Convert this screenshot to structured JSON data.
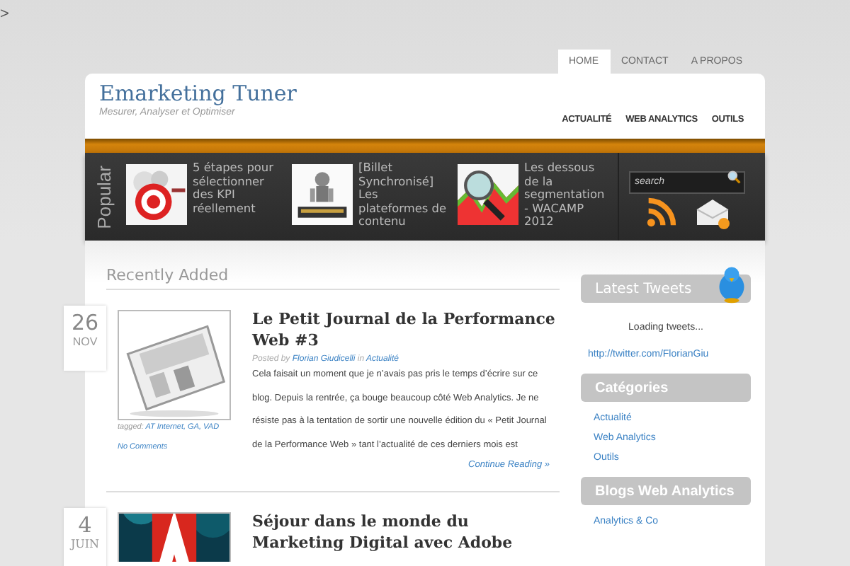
{
  "top_marker": ">",
  "top_tabs": [
    {
      "label": "HOME",
      "selected": true
    },
    {
      "label": "CONTACT",
      "selected": false
    },
    {
      "label": "A PROPOS",
      "selected": false
    }
  ],
  "site": {
    "title": "Emarketing Tuner",
    "tagline": "Mesurer, Analyser et Optimiser"
  },
  "nav": [
    "ACTUALITÉ",
    "WEB ANALYTICS",
    "OUTILS"
  ],
  "popular": {
    "label": "Popular",
    "items": [
      {
        "title": "5 étapes pour sélectionner des KPI réellement"
      },
      {
        "title": "[Billet Synchronisé] Les plateformes de contenu"
      },
      {
        "title": "Les dessous de la segmentation - WACAMP 2012"
      }
    ],
    "search": {
      "placeholder": "search"
    }
  },
  "recent": {
    "heading": "Recently Added",
    "posts": [
      {
        "day": "26",
        "month": "NOV",
        "title": "Le Petit Journal de la Performance Web #3",
        "posted_by": "Posted by",
        "author": "Florian Giudicelli",
        "in": "in",
        "category": "Actualité",
        "excerpt": "Cela faisait un moment que je n’avais pas pris le temps d’écrire sur ce blog. Depuis la rentrée, ça bouge beaucoup côté Web Analytics. Je ne résiste pas à la tentation de sortir une nouvelle édition du « Petit Journal de la Performance Web » tant l’actualité de ces derniers mois est",
        "tagged": "tagged:",
        "tags": "AT Internet, GA, VAD",
        "comments": "No Comments",
        "more": "Continue Reading »"
      },
      {
        "day": "4",
        "month": "JUIN",
        "title": "Séjour dans le monde du Marketing Digital avec Adobe"
      }
    ]
  },
  "sidebar": {
    "tweets": {
      "heading": "Latest Tweets",
      "status": "Loading tweets...",
      "link": "http://twitter.com/FlorianGiu"
    },
    "categories": {
      "heading": "Catégories",
      "items": [
        "Actualité",
        "Web Analytics",
        "Outils"
      ]
    },
    "blogs": {
      "heading": "Blogs Web Analytics",
      "items": [
        "Analytics & Co"
      ]
    }
  }
}
